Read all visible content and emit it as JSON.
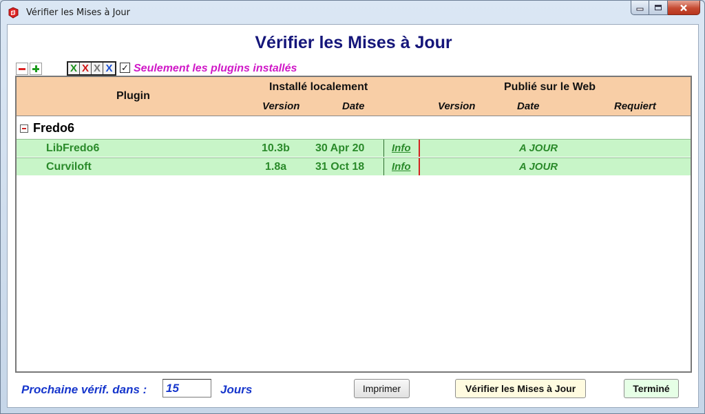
{
  "window": {
    "title": "Vérifier les Mises à Jour",
    "accent": "#15167a"
  },
  "main_title": "Vérifier les Mises à Jour",
  "toolbar": {
    "x_buttons": [
      "X",
      "X",
      "X",
      "X"
    ],
    "only_installed_checked": true,
    "only_installed_mark": "✓",
    "only_installed_label": "Seulement les plugins installés"
  },
  "table": {
    "headers": {
      "plugin": "Plugin",
      "local_group": "Installé localement",
      "web_group": "Publié sur le Web",
      "local_version": "Version",
      "local_date": "Date",
      "web_version": "Version",
      "web_date": "Date",
      "web_requires": "Requiert"
    },
    "groups": [
      {
        "name": "Fredo6",
        "rows": [
          {
            "plugin": "LibFredo6",
            "version": "10.3b",
            "date": "30 Apr 20",
            "info": "Info",
            "status": "A JOUR"
          },
          {
            "plugin": "Curviloft",
            "version": "1.8a",
            "date": "31 Oct 18",
            "info": "Info",
            "status": "A JOUR"
          }
        ]
      }
    ]
  },
  "footer": {
    "next_check_label": "Prochaine vérif. dans :",
    "days_value": "15",
    "days_unit": "Jours",
    "print_label": "Imprimer",
    "check_label": "Vérifier les Mises à Jour",
    "done_label": "Terminé"
  },
  "colors": {
    "header_bg": "#f8cea6",
    "row_bg": "#c8f5c8",
    "row_text": "#2a8a2a",
    "blue_text": "#1636cc",
    "magenta_text": "#d019c7"
  }
}
